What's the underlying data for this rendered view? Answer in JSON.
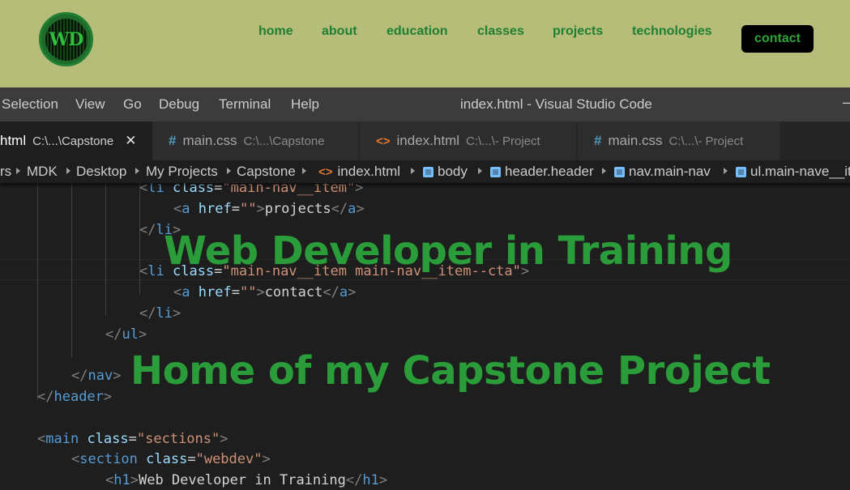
{
  "site": {
    "logo_text": "WD",
    "nav": [
      {
        "label": "home"
      },
      {
        "label": "about"
      },
      {
        "label": "education"
      },
      {
        "label": "classes"
      },
      {
        "label": "projects"
      },
      {
        "label": "technologies"
      }
    ],
    "cta_label": "contact",
    "colors": {
      "header_bg": "#b5bd78",
      "accent": "#1f7f33",
      "cta_bg": "#000000"
    }
  },
  "hero": {
    "title": "Web Developer in Training",
    "subtitle": "Home of my Capstone Project"
  },
  "editor": {
    "menu": [
      "Selection",
      "View",
      "Go",
      "Debug",
      "Terminal",
      "Help"
    ],
    "window_title": "index.html - Visual Studio Code",
    "window_control": "–",
    "tabs": [
      {
        "icon": "html-icon",
        "name": "html",
        "path": "C:\\...\\Capstone",
        "active": true,
        "close": "✕"
      },
      {
        "icon": "css-icon",
        "name": "main.css",
        "path": "C:\\...\\Capstone",
        "active": false
      },
      {
        "icon": "html-icon",
        "name": "index.html",
        "path": "C:\\...\\- Project",
        "active": false
      },
      {
        "icon": "css-icon",
        "name": "main.css",
        "path": "C:\\...\\- Project",
        "active": false
      }
    ],
    "breadcrumbs": [
      "rs",
      "MDK",
      "Desktop",
      "My Projects",
      "Capstone",
      "index.html",
      "body",
      "header.header",
      "nav.main-nav",
      "ul.main-nave__it"
    ],
    "code_lines": [
      {
        "tokens": [
          [
            "punct",
            "<"
          ],
          [
            "tag",
            "li"
          ],
          [
            "text",
            " "
          ],
          [
            "attr",
            "class"
          ],
          [
            "text",
            "="
          ],
          [
            "str",
            "\"main-nav__item\""
          ],
          [
            "punct",
            ">"
          ]
        ]
      },
      {
        "tokens": [
          [
            "punct",
            "<"
          ],
          [
            "tag",
            "a"
          ],
          [
            "text",
            " "
          ],
          [
            "attr",
            "href"
          ],
          [
            "text",
            "="
          ],
          [
            "str",
            "\"\""
          ],
          [
            "punct",
            ">"
          ],
          [
            "text",
            "projects"
          ],
          [
            "punct",
            "</"
          ],
          [
            "tag",
            "a"
          ],
          [
            "punct",
            ">"
          ]
        ]
      },
      {
        "tokens": [
          [
            "punct",
            "</"
          ],
          [
            "tag",
            "li"
          ],
          [
            "punct",
            ">"
          ]
        ]
      },
      {
        "tokens": []
      },
      {
        "tokens": [
          [
            "punct",
            "<"
          ],
          [
            "tag",
            "li"
          ],
          [
            "text",
            " "
          ],
          [
            "attr",
            "class"
          ],
          [
            "text",
            "="
          ],
          [
            "str",
            "\"main-nav__item main-nav__item--cta\""
          ],
          [
            "punct",
            ">"
          ]
        ]
      },
      {
        "tokens": [
          [
            "punct",
            "<"
          ],
          [
            "tag",
            "a"
          ],
          [
            "text",
            " "
          ],
          [
            "attr",
            "href"
          ],
          [
            "text",
            "="
          ],
          [
            "str",
            "\"\""
          ],
          [
            "punct",
            ">"
          ],
          [
            "text",
            "contact"
          ],
          [
            "punct",
            "</"
          ],
          [
            "tag",
            "a"
          ],
          [
            "punct",
            ">"
          ]
        ]
      },
      {
        "tokens": [
          [
            "punct",
            "</"
          ],
          [
            "tag",
            "li"
          ],
          [
            "punct",
            ">"
          ]
        ]
      },
      {
        "tokens": [
          [
            "punct",
            "</"
          ],
          [
            "tag",
            "ul"
          ],
          [
            "punct",
            ">"
          ]
        ]
      },
      {
        "tokens": []
      },
      {
        "tokens": [
          [
            "punct",
            "</"
          ],
          [
            "tag",
            "nav"
          ],
          [
            "punct",
            ">"
          ]
        ]
      },
      {
        "tokens": [
          [
            "punct",
            "</"
          ],
          [
            "tag",
            "header"
          ],
          [
            "punct",
            ">"
          ]
        ]
      },
      {
        "tokens": []
      },
      {
        "tokens": [
          [
            "punct",
            "<"
          ],
          [
            "tag",
            "main"
          ],
          [
            "text",
            " "
          ],
          [
            "attr",
            "class"
          ],
          [
            "text",
            "="
          ],
          [
            "str",
            "\"sections\""
          ],
          [
            "punct",
            ">"
          ]
        ]
      },
      {
        "tokens": [
          [
            "punct",
            "<"
          ],
          [
            "tag",
            "section"
          ],
          [
            "text",
            " "
          ],
          [
            "attr",
            "class"
          ],
          [
            "text",
            "="
          ],
          [
            "str",
            "\"webdev\""
          ],
          [
            "punct",
            ">"
          ]
        ]
      },
      {
        "tokens": [
          [
            "punct",
            "<"
          ],
          [
            "tag",
            "h1"
          ],
          [
            "punct",
            ">"
          ],
          [
            "text",
            "Web Developer in Training"
          ],
          [
            "punct",
            "</"
          ],
          [
            "tag",
            "h1"
          ],
          [
            "punct",
            ">"
          ]
        ]
      }
    ]
  }
}
